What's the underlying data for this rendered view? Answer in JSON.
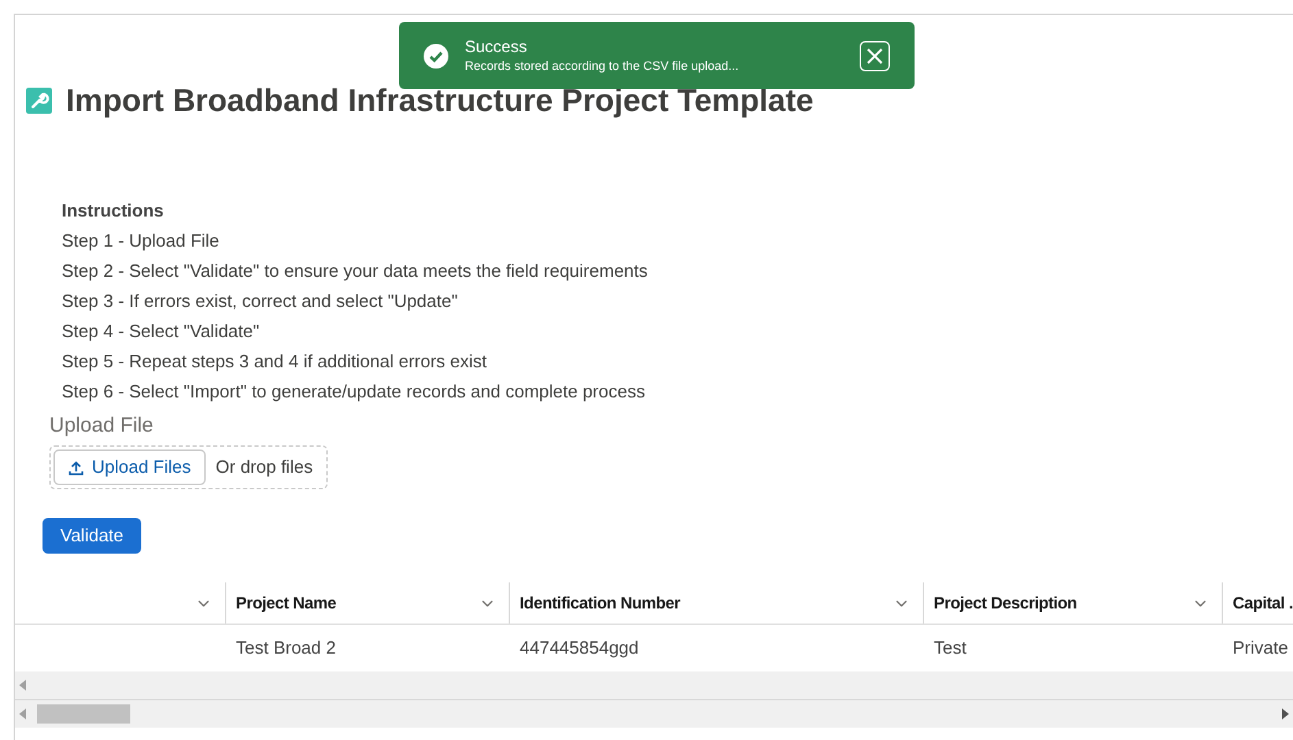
{
  "toast": {
    "title": "Success",
    "message": "Records stored according to the CSV file upload..."
  },
  "page": {
    "title": "Import Broadband Infrastructure Project Template"
  },
  "instructions": {
    "heading": "Instructions",
    "steps": [
      "Step 1 - Upload File",
      "Step 2 - Select \"Validate\" to ensure your data meets the field requirements",
      "Step 3 - If errors exist, correct and select \"Update\"",
      "Step 4 - Select \"Validate\"",
      "Step 5 - Repeat steps 3 and 4 if additional errors exist",
      "Step 6 - Select \"Import\" to generate/update records and complete process"
    ]
  },
  "upload": {
    "label": "Upload File",
    "button": "Upload Files",
    "drop_text": "Or drop files"
  },
  "validate_button": "Validate",
  "table": {
    "columns": [
      "",
      "Project Name",
      "Identification Number",
      "Project Description",
      "Capital ."
    ],
    "rows": [
      [
        "",
        "Test Broad 2",
        "447445854ggd",
        "Test",
        "Private"
      ]
    ]
  }
}
